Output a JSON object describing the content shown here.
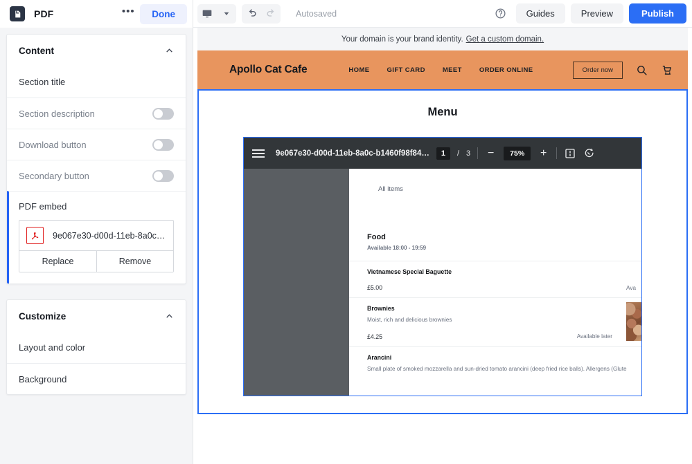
{
  "left_panel": {
    "badge_icon": "pdf-file-icon",
    "title": "PDF",
    "more_label": "•••",
    "done_label": "Done",
    "sections": [
      {
        "title": "Content",
        "collapse_icon": "chevron-up-icon",
        "rows": [
          {
            "label": "Section title",
            "type": "text"
          },
          {
            "label": "Section description",
            "type": "toggle",
            "value": "off"
          },
          {
            "label": "Download button",
            "type": "toggle",
            "value": "off"
          },
          {
            "label": "Secondary button",
            "type": "toggle",
            "value": "off"
          }
        ],
        "selected_row": {
          "label": "PDF embed",
          "file_icon": "acrobat-pdf-icon",
          "file_name": "9e067e30-d00d-11eb-8a0c-b1…",
          "replace_label": "Replace",
          "remove_label": "Remove"
        }
      },
      {
        "title": "Customize",
        "collapse_icon": "chevron-up-icon",
        "rows": [
          {
            "label": "Layout and color",
            "type": "link"
          },
          {
            "label": "Background",
            "type": "link"
          }
        ]
      }
    ]
  },
  "toolbar": {
    "device_icon": "desktop-monitor-icon",
    "device_chevron_icon": "chevron-down-icon",
    "undo_icon": "undo-arrow-icon",
    "redo_icon": "redo-arrow-icon",
    "autosaved_label": "Autosaved",
    "help_icon": "question-mark-circle-icon",
    "guides_label": "Guides",
    "preview_label": "Preview",
    "publish_label": "Publish",
    "publish_color": "#2b6ef5"
  },
  "domain_bar": {
    "text": "Your domain is your brand identity.",
    "link_label": "Get a custom domain."
  },
  "site_header": {
    "brand": "Apollo Cat Cafe",
    "background_color": "#e8955e",
    "nav": [
      "HOME",
      "GIFT CARD",
      "MEET",
      "ORDER ONLINE"
    ],
    "order_button_label": "Order now",
    "search_icon": "search-icon",
    "cart_icon": "shopping-cart-icon"
  },
  "section": {
    "heading": "Menu",
    "selection_color": "#2b6ef5"
  },
  "pdf_viewer": {
    "menu_icon": "hamburger-menu-icon",
    "file_name": "9e067e30-d00d-11eb-8a0c-b1460f98f84…",
    "page_current": "1",
    "page_separator": "/",
    "page_total": "3",
    "zoom_out_icon": "minus-icon",
    "zoom_value": "75%",
    "zoom_in_icon": "plus-icon",
    "fit_page_icon": "fit-to-page-icon",
    "rotate_icon": "rotate-icon",
    "document": {
      "all_items_label": "All items",
      "category": "Food",
      "category_availability": "Available 18:00 - 19:59",
      "items": [
        {
          "name": "Vietnamese Special Baguette",
          "description": "",
          "price": "£5.00",
          "availability": "Ava"
        },
        {
          "name": "Brownies",
          "description": "Moist, rich and delicious brownies",
          "price": "£4.25",
          "availability": "Available later",
          "thumbnail": "brownies-photo"
        },
        {
          "name": "Arancini",
          "description": "Small plate of smoked mozzarella and sun-dried tomato arancini (deep fried rice balls). Allergens (Glute",
          "price": "",
          "availability": ""
        }
      ]
    }
  }
}
